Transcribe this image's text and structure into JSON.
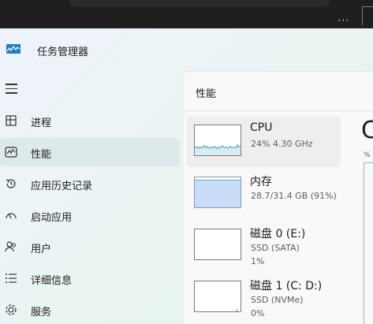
{
  "app": {
    "title": "任务管理器",
    "icon": "task-manager-icon"
  },
  "sidebar": {
    "items": [
      {
        "label": "进程",
        "icon": "processes-icon",
        "active": false
      },
      {
        "label": "性能",
        "icon": "performance-icon",
        "active": true
      },
      {
        "label": "应用历史记录",
        "icon": "history-icon",
        "active": false
      },
      {
        "label": "启动应用",
        "icon": "startup-icon",
        "active": false
      },
      {
        "label": "用户",
        "icon": "users-icon",
        "active": false
      },
      {
        "label": "详细信息",
        "icon": "details-icon",
        "active": false
      },
      {
        "label": "服务",
        "icon": "services-icon",
        "active": false
      }
    ]
  },
  "content": {
    "title": "性能",
    "big_letter": "C",
    "pct_label": "%",
    "resources": [
      {
        "name": "CPU",
        "sub1": "24% 4.30 GHz",
        "sub2": "",
        "selected": true
      },
      {
        "name": "内存",
        "sub1": "28.7/31.4 GB (91%)",
        "sub2": "",
        "selected": false
      },
      {
        "name": "磁盘 0 (E:)",
        "sub1": "SSD (SATA)",
        "sub2": "1%",
        "selected": false
      },
      {
        "name": "磁盘 1 (C: D:)",
        "sub1": "SSD (NVMe)",
        "sub2": "0%",
        "selected": false
      }
    ]
  },
  "colors": {
    "accent": "#2a8fbd",
    "memory_fill": "#c9dcf8",
    "sidebar_active": "#dde9ea"
  }
}
